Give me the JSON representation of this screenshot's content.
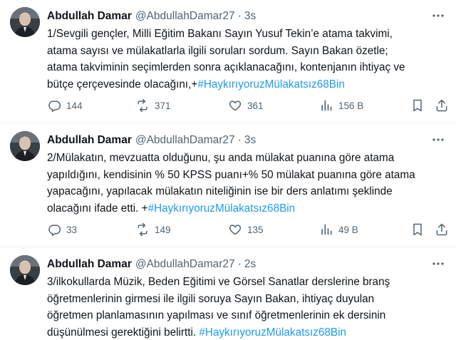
{
  "tweets": [
    {
      "name": "Abdullah Damar",
      "handle": "@AbdullahDamar27",
      "separator": "·",
      "time": "3s",
      "lines": [
        "1/Sevgili gençler, Milli Eğitim Bakanı Sayın Yusuf Tekin’e atama takvimi,",
        "atama sayısı ve mülakatlarla ilgili soruları sordum. Sayın Bakan özetle;",
        "atama takviminin seçimlerden sonra açıklanacağını, kontenjanın ihtiyaç ve",
        "bütçe çerçevesinde olacağını,+"
      ],
      "hashtag": "#HaykırıyoruzMülakatsız68Bin",
      "replies": "144",
      "retweets": "371",
      "likes": "361",
      "views": "156 B"
    },
    {
      "name": "Abdullah Damar",
      "handle": "@AbdullahDamar27",
      "separator": "·",
      "time": "3s",
      "lines": [
        "2/Mülakatın, mevzuatta olduğunu, şu anda mülakat puanına göre atama",
        "yapıldığını, kendisinin % 50 KPSS puanı+% 50 mülakat puanına göre atama",
        "yapacağını, yapılacak mülakatın niteliğinin ise bir ders anlatımı şeklinde",
        "olacağını ifade etti. +"
      ],
      "hashtag": "#HaykırıyoruzMülakatsız68Bin",
      "replies": "33",
      "retweets": "149",
      "likes": "135",
      "views": "49 B"
    },
    {
      "name": "Abdullah Damar",
      "handle": "@AbdullahDamar27",
      "separator": "·",
      "time": "2s",
      "lines": [
        "3/ilkokullarda Müzik, Beden Eğitimi ve Görsel Sanatlar derslerine branş",
        "öğretmenlerinin girmesi ile ilgili soruya Sayın Bakan, ihtiyaç duyulan",
        "öğretmen planlamasının yapılması ve  sınıf öğretmenlerinin ek dersinin",
        "düşünülmesi gerektiğini belirtti. "
      ],
      "hashtag": "#HaykırıyoruzMülakatsız68Bin"
    }
  ],
  "icons": {
    "reply": "reply-icon",
    "retweet": "retweet-icon",
    "like": "like-icon",
    "views": "views-icon",
    "bookmark": "bookmark-icon",
    "share": "share-icon",
    "more": "more-icon"
  },
  "colors": {
    "text": "#0f1419",
    "secondary": "#536471",
    "hashtag": "#1d9bf0",
    "divider": "#eff3f4"
  }
}
